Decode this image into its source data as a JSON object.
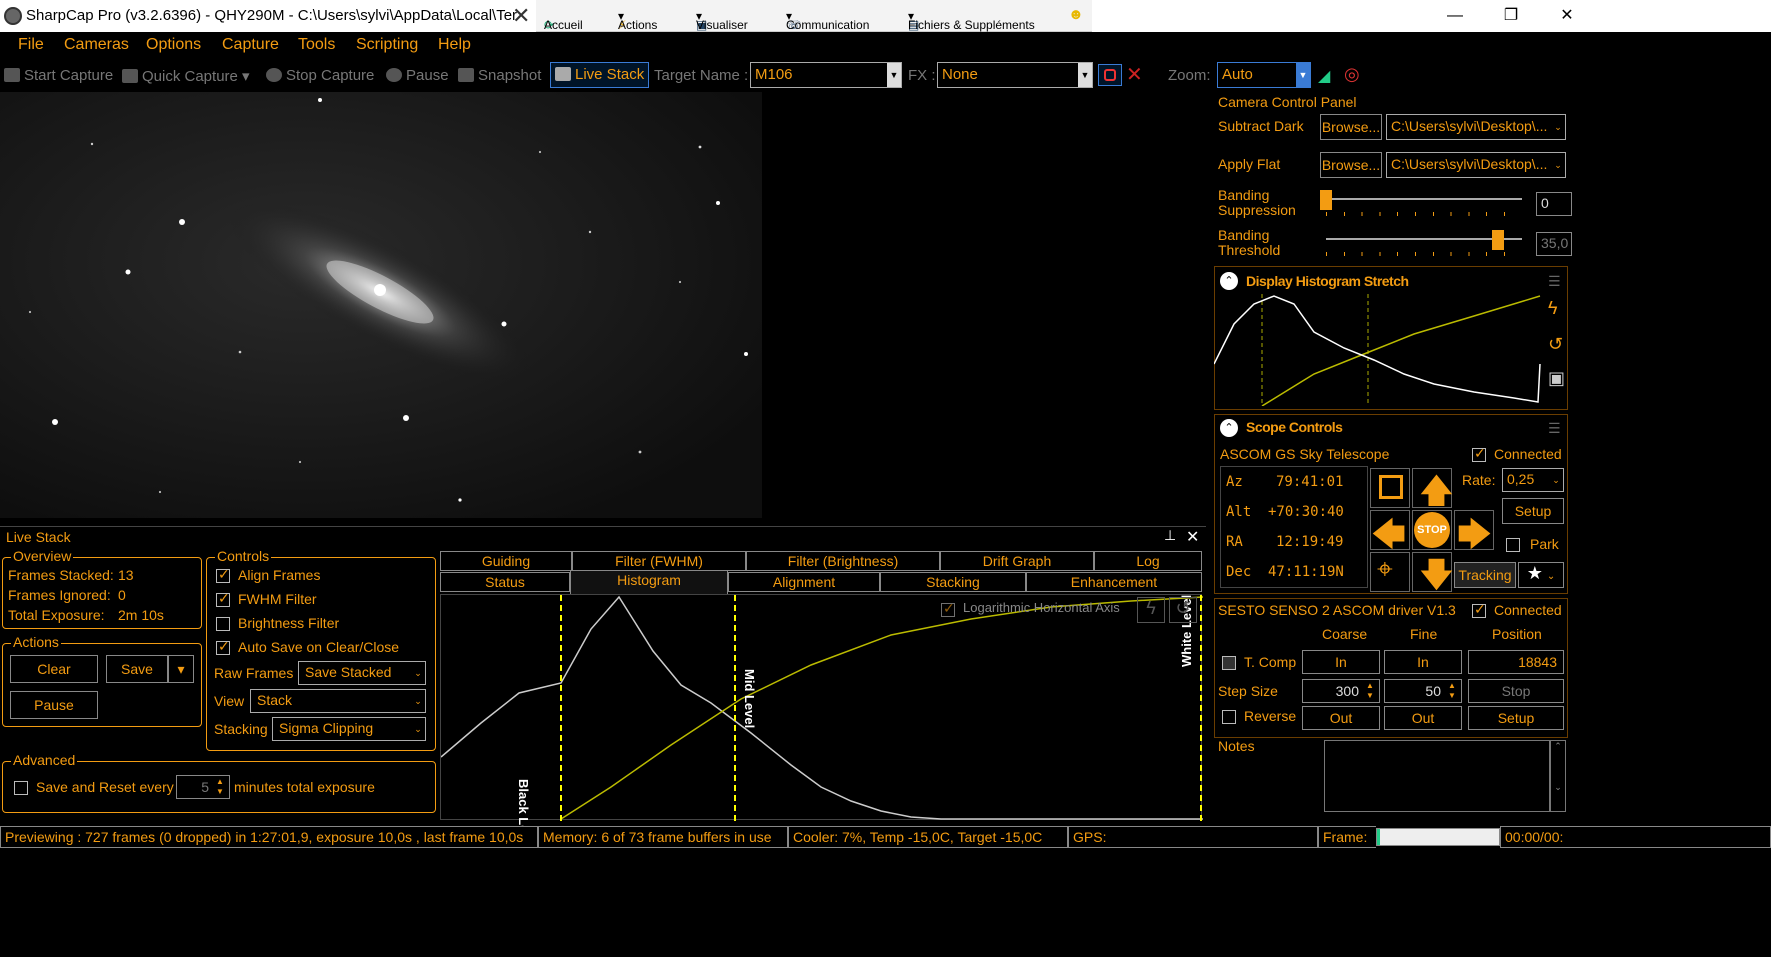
{
  "window": {
    "title": "SharpCap Pro (v3.2.6396) - QHY290M - C:\\Users\\sylvi\\AppData\\Local\\Ter"
  },
  "floating_bar": {
    "items": [
      "Accueil",
      "Actions",
      "Visualiser",
      "Communication",
      "Fichiers & Suppléments"
    ]
  },
  "menu": [
    "File",
    "Cameras",
    "Options",
    "Capture",
    "Tools",
    "Scripting",
    "Help"
  ],
  "toolbar": {
    "start_capture": "Start Capture",
    "quick_capture": "Quick Capture",
    "stop_capture": "Stop Capture",
    "pause": "Pause",
    "snapshot": "Snapshot",
    "live_stack": "Live Stack",
    "target_name_label": "Target Name :",
    "target_name_value": "M106",
    "fx_label": "FX :",
    "fx_value": "None",
    "zoom_label": "Zoom:",
    "zoom_value": "Auto"
  },
  "camera_panel": {
    "title": "Camera Control Panel",
    "subtract_dark": "Subtract Dark",
    "apply_flat": "Apply Flat",
    "browse": "Browse...",
    "dark_path": "C:\\Users\\sylvi\\Desktop\\...",
    "flat_path": "C:\\Users\\sylvi\\Desktop\\...",
    "banding_suppression_label": "Banding\nSuppression",
    "banding_suppression_value": "0",
    "banding_suppression_level": 0.0,
    "banding_threshold_label": "Banding\nThreshold",
    "banding_threshold_value": "35,0",
    "banding_threshold_level": 0.88
  },
  "histogram_stretch": {
    "title": "Display Histogram Stretch"
  },
  "scope": {
    "title": "Scope Controls",
    "mount": "ASCOM GS Sky Telescope",
    "connected": "Connected",
    "az_label": "Az",
    "az": "79:41:01",
    "alt_label": "Alt",
    "alt": "+70:30:40",
    "ra_label": "RA",
    "ra": "12:19:49",
    "dec_label": "Dec",
    "dec": "47:11:19N",
    "rate_label": "Rate:",
    "rate": "0,25",
    "setup": "Setup",
    "park": "Park",
    "tracking": "Tracking",
    "stop": "STOP"
  },
  "focuser": {
    "title": "SESTO SENSO 2 ASCOM driver V1.3",
    "connected": "Connected",
    "coarse": "Coarse",
    "fine": "Fine",
    "position": "Position",
    "tcomp": "T. Comp",
    "in": "In",
    "out": "Out",
    "position_value": "18843",
    "step_size_label": "Step Size",
    "step_coarse": "300",
    "step_fine": "50",
    "stop": "Stop",
    "setup": "Setup",
    "reverse": "Reverse"
  },
  "notes": {
    "label": "Notes"
  },
  "live_stack": {
    "title": "Live Stack",
    "overview": {
      "title": "Overview",
      "frames_stacked_label": "Frames Stacked:",
      "frames_stacked": "13",
      "frames_ignored_label": "Frames Ignored:",
      "frames_ignored": "0",
      "total_exposure_label": "Total Exposure:",
      "total_exposure": "2m 10s"
    },
    "actions": {
      "title": "Actions",
      "clear": "Clear",
      "save": "Save",
      "pause": "Pause"
    },
    "controls": {
      "title": "Controls",
      "align_frames": "Align Frames",
      "fwhm_filter": "FWHM Filter",
      "brightness_filter": "Brightness Filter",
      "auto_save": "Auto Save on Clear/Close",
      "raw_frames_label": "Raw Frames",
      "raw_frames_value": "Save Stacked",
      "view_label": "View",
      "view_value": "Stack",
      "stacking_label": "Stacking",
      "stacking_value": "Sigma Clipping"
    },
    "advanced": {
      "title": "Advanced",
      "save_reset_label": "Save and Reset every",
      "save_reset_value": "5",
      "save_reset_suffix": "minutes total exposure"
    },
    "tabs_top": [
      "Guiding",
      "Filter (FWHM)",
      "Filter (Brightness)",
      "Drift Graph",
      "Log"
    ],
    "tabs_bottom": [
      "Status",
      "Histogram",
      "Alignment",
      "Stacking",
      "Enhancement"
    ],
    "histogram": {
      "log_axis": "Logarithmic Horizontal Axis",
      "black_level": "Black Level",
      "mid_level": "Mid Level",
      "white_level": "White Level"
    }
  },
  "statusbar": {
    "preview": "Previewing : 727 frames (0 dropped) in 1:27:01,9, exposure 10,0s , last frame 10,0s",
    "memory": "Memory: 6 of 73 frame buffers in use",
    "cooler": "Cooler: 7%, Temp -15,0C, Target -15,0C",
    "gps": "GPS:",
    "frame": "Frame:",
    "time": "00:00/00:"
  }
}
